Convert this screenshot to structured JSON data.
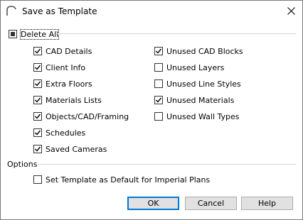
{
  "window": {
    "title": "Save as Template"
  },
  "delete_all": {
    "label": "Delete All",
    "state": "indeterminate"
  },
  "left_column": [
    {
      "label": "CAD Details",
      "checked": true
    },
    {
      "label": "Client Info",
      "checked": true
    },
    {
      "label": "Extra Floors",
      "checked": true
    },
    {
      "label": "Materials Lists",
      "checked": true
    },
    {
      "label": "Objects/CAD/Framing",
      "checked": true
    },
    {
      "label": "Schedules",
      "checked": true
    },
    {
      "label": "Saved Cameras",
      "checked": true
    }
  ],
  "right_column": [
    {
      "label": "Unused CAD Blocks",
      "checked": true
    },
    {
      "label": "Unused Layers",
      "checked": false
    },
    {
      "label": "Unused Line Styles",
      "checked": false
    },
    {
      "label": "Unused Materials",
      "checked": true
    },
    {
      "label": "Unused Wall Types",
      "checked": false
    }
  ],
  "options": {
    "heading": "Options",
    "default_template": {
      "label": "Set Template as Default for Imperial Plans",
      "checked": false
    }
  },
  "buttons": {
    "ok": "OK",
    "cancel": "Cancel",
    "help": "Help"
  },
  "colors": {
    "accent": "#0078d7",
    "button_face": "#e1e1e1",
    "window_border": "#7a7a7a"
  }
}
